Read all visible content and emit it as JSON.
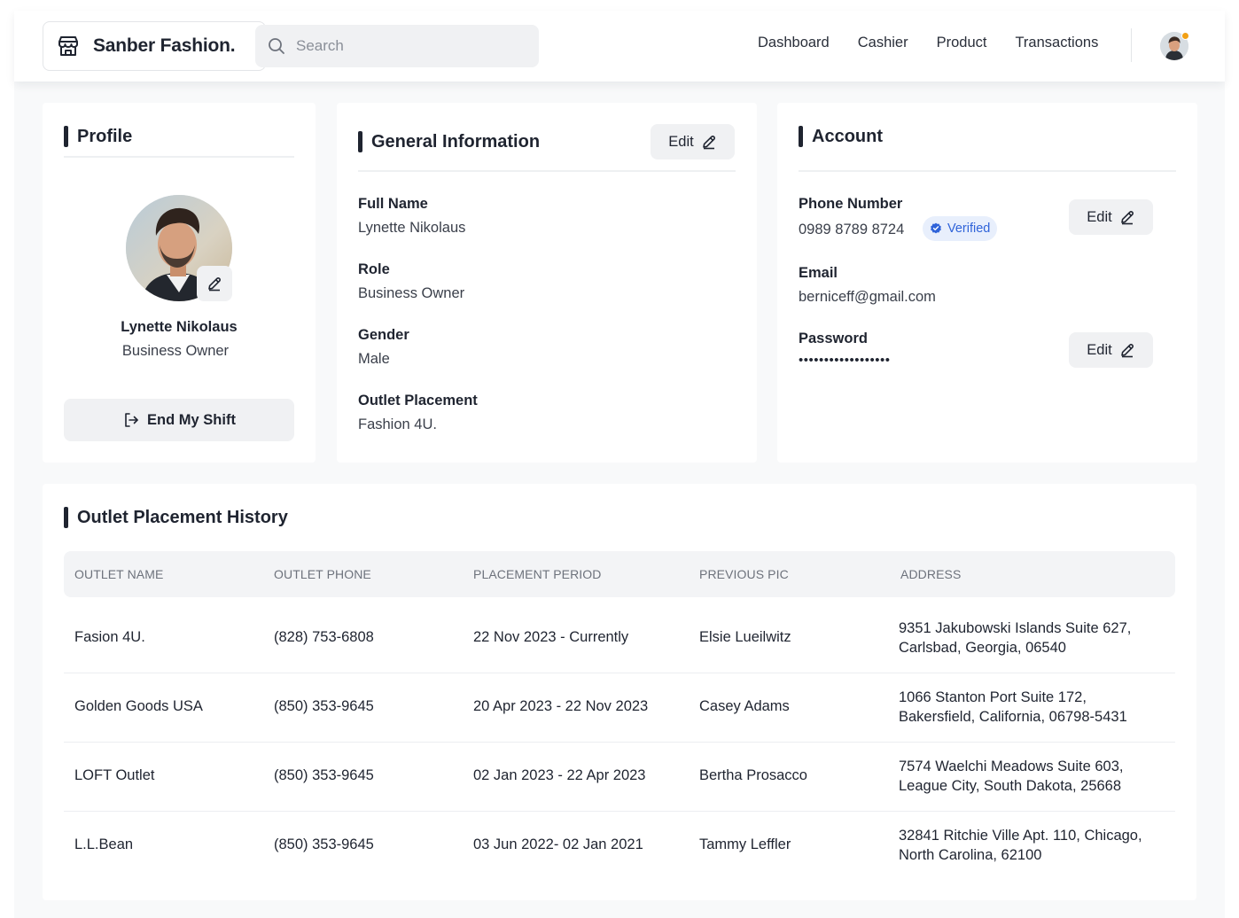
{
  "header": {
    "brand_name": "Sanber Fashion.",
    "search_placeholder": "Search",
    "nav": [
      "Dashboard",
      "Cashier",
      "Product",
      "Transactions"
    ]
  },
  "profile": {
    "title": "Profile",
    "name": "Lynette Nikolaus",
    "role": "Business Owner",
    "end_shift_label": "End My Shift"
  },
  "general": {
    "title": "General Information",
    "edit_label": "Edit",
    "fields": [
      {
        "label": "Full Name",
        "value": "Lynette Nikolaus"
      },
      {
        "label": "Role",
        "value": "Business Owner"
      },
      {
        "label": "Gender",
        "value": "Male"
      },
      {
        "label": "Outlet Placement",
        "value": "Fashion 4U."
      }
    ]
  },
  "account": {
    "title": "Account",
    "phone_label": "Phone Number",
    "phone_value": "0989 8789 8724",
    "verified_label": "Verified",
    "email_label": "Email",
    "email_value": "berniceff@gmail.com",
    "password_label": "Password",
    "password_value": "••••••••••••••••••",
    "edit_label": "Edit"
  },
  "history": {
    "title": "Outlet Placement History",
    "columns": [
      "OUTLET NAME",
      "OUTLET PHONE",
      "PLACEMENT PERIOD",
      "PREVIOUS PIC",
      "ADDRESS"
    ],
    "rows": [
      [
        "Fasion 4U.",
        "(828) 753-6808",
        "22 Nov 2023 - Currently",
        "Elsie Lueilwitz",
        "9351 Jakubowski Islands Suite 627, Carlsbad, Georgia, 06540"
      ],
      [
        "Golden Goods USA",
        "(850) 353-9645",
        "20 Apr 2023 - 22 Nov 2023",
        "Casey Adams",
        "1066 Stanton Port Suite 172, Bakersfield, California, 06798-5431"
      ],
      [
        "LOFT Outlet",
        "(850) 353-9645",
        "02 Jan 2023 - 22 Apr 2023",
        "Bertha Prosacco",
        "7574 Waelchi Meadows Suite 603, League City, South Dakota, 25668"
      ],
      [
        "L.L.Bean",
        "(850) 353-9645",
        "03 Jun 2022- 02 Jan 2021",
        "Tammy Leffler",
        "32841 Ritchie Ville Apt. 110, Chicago, North Carolina, 62100"
      ]
    ]
  },
  "colors": {
    "text": "#1f2430",
    "surface": "#f0f1f3",
    "verified": "#2f63d9",
    "notification_dot": "#f2a014"
  },
  "icons": [
    "store-icon",
    "search-icon",
    "edit-pencil-icon",
    "logout-icon",
    "verified-badge-icon"
  ]
}
